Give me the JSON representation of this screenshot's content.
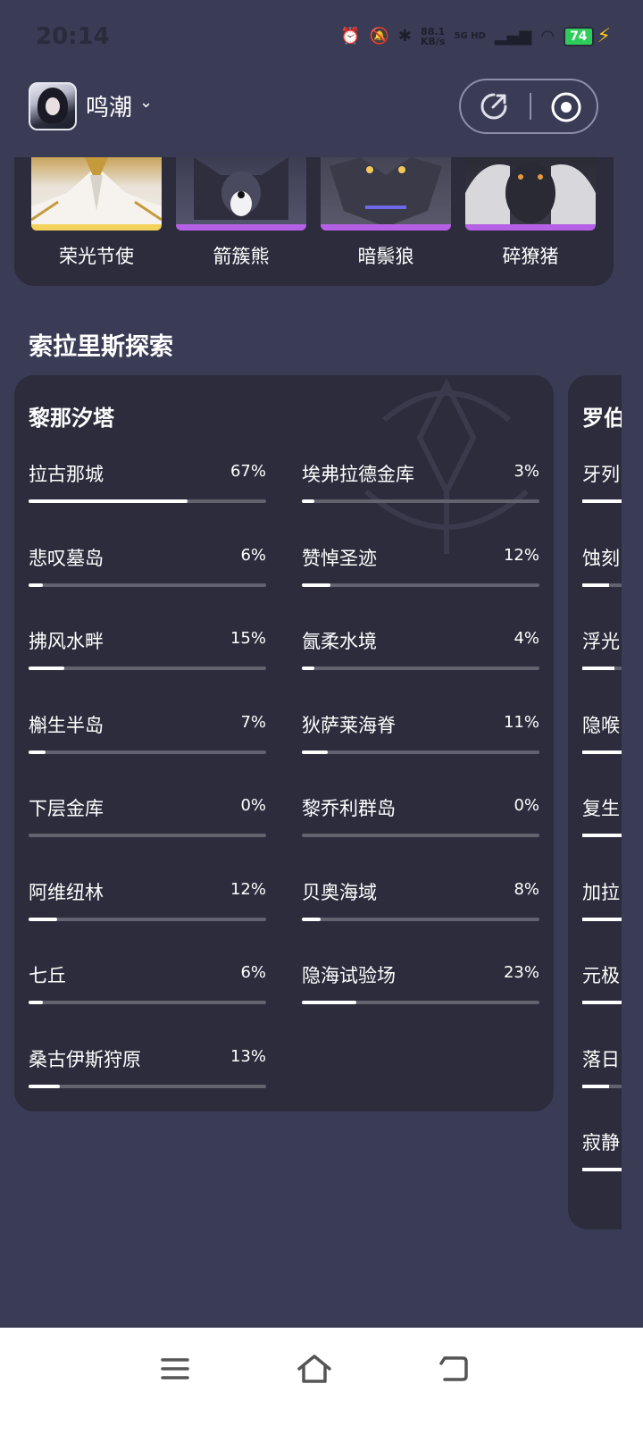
{
  "status_bar": {
    "time": "20:14",
    "net_speed_value": "88.1",
    "net_speed_unit": "KB/s",
    "network_type": "5G HD",
    "battery": "74"
  },
  "header": {
    "game_name": "鸣潮"
  },
  "monsters": [
    {
      "name": "荣光节使",
      "rarity_color": "#f3d25b"
    },
    {
      "name": "箭簇熊",
      "rarity_color": "#b561e6"
    },
    {
      "name": "暗鬃狼",
      "rarity_color": "#b561e6"
    },
    {
      "name": "碎獠猪",
      "rarity_color": "#b561e6"
    }
  ],
  "section": {
    "title": "索拉里斯探索"
  },
  "region": {
    "name": "黎那汐塔",
    "areas": [
      {
        "name": "拉古那城",
        "percent": "67%",
        "progress": 0.67
      },
      {
        "name": "埃弗拉德金库",
        "percent": "3%",
        "progress": 0.03
      },
      {
        "name": "悲叹墓岛",
        "percent": "6%",
        "progress": 0.06
      },
      {
        "name": "赞悼圣迹",
        "percent": "12%",
        "progress": 0.12
      },
      {
        "name": "拂风水畔",
        "percent": "15%",
        "progress": 0.15
      },
      {
        "name": "氤柔水境",
        "percent": "4%",
        "progress": 0.04
      },
      {
        "name": "槲生半岛",
        "percent": "7%",
        "progress": 0.07
      },
      {
        "name": "狄萨莱海脊",
        "percent": "11%",
        "progress": 0.11
      },
      {
        "name": "下层金库",
        "percent": "0%",
        "progress": 0.0
      },
      {
        "name": "黎乔利群岛",
        "percent": "0%",
        "progress": 0.0
      },
      {
        "name": "阿维纽林",
        "percent": "12%",
        "progress": 0.12
      },
      {
        "name": "贝奥海域",
        "percent": "8%",
        "progress": 0.08
      },
      {
        "name": "七丘",
        "percent": "6%",
        "progress": 0.06
      },
      {
        "name": "隐海试验场",
        "percent": "23%",
        "progress": 0.23
      },
      {
        "name": "桑古伊斯狩原",
        "percent": "13%",
        "progress": 0.13
      }
    ]
  },
  "next_region": {
    "name_partial": "罗伯",
    "areas_partial": [
      {
        "name": "牙列",
        "progress": 1.0
      },
      {
        "name": "蚀刻",
        "progress": 0.5
      },
      {
        "name": "浮光",
        "progress": 0.6
      },
      {
        "name": "隐喉",
        "progress": 1.0
      },
      {
        "name": "复生",
        "progress": 1.0
      },
      {
        "name": "加拉",
        "progress": 1.0
      },
      {
        "name": "元极",
        "progress": 1.0
      },
      {
        "name": "落日",
        "progress": 0.5
      },
      {
        "name": "寂静",
        "progress": 0.75
      }
    ]
  },
  "icons": {
    "share": "share-icon",
    "record": "record-icon",
    "menu": "menu-icon",
    "home": "home-icon",
    "back": "back-icon"
  }
}
